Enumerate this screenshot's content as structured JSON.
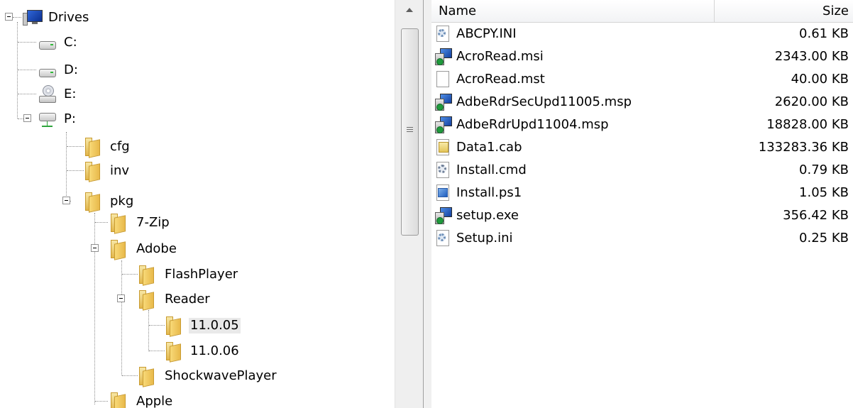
{
  "tree": {
    "root": {
      "label": "Drives",
      "icon": "computer-icon"
    },
    "drives": [
      {
        "label": "C:",
        "icon": "drive-icon"
      },
      {
        "label": "D:",
        "icon": "drive-icon"
      },
      {
        "label": "E:",
        "icon": "optical-drive-icon"
      },
      {
        "label": "P:",
        "icon": "network-drive-icon"
      }
    ],
    "p_children": [
      {
        "label": "cfg"
      },
      {
        "label": "inv"
      },
      {
        "label": "pkg"
      }
    ],
    "pkg_children": [
      {
        "label": "7-Zip"
      },
      {
        "label": "Adobe"
      }
    ],
    "adobe_children": [
      {
        "label": "FlashPlayer"
      },
      {
        "label": "Reader"
      },
      {
        "label": "ShockwavePlayer"
      }
    ],
    "reader_children": [
      {
        "label": "11.0.05",
        "selected": true
      },
      {
        "label": "11.0.06"
      }
    ],
    "after_adobe": [
      {
        "label": "Apple"
      }
    ]
  },
  "list": {
    "columns": {
      "name": "Name",
      "size": "Size"
    },
    "files": [
      {
        "name": "ABCPY.INI",
        "size": "0.61 KB",
        "icon": "ini-icon"
      },
      {
        "name": "AcroRead.msi",
        "size": "2343.00 KB",
        "icon": "installer-icon"
      },
      {
        "name": "AcroRead.mst",
        "size": "40.00 KB",
        "icon": "blank-file-icon"
      },
      {
        "name": "AdbeRdrSecUpd11005.msp",
        "size": "2620.00 KB",
        "icon": "installer-icon"
      },
      {
        "name": "AdbeRdrUpd11004.msp",
        "size": "18828.00 KB",
        "icon": "installer-icon"
      },
      {
        "name": "Data1.cab",
        "size": "133283.36 KB",
        "icon": "cabinet-icon"
      },
      {
        "name": "Install.cmd",
        "size": "0.79 KB",
        "icon": "script-icon"
      },
      {
        "name": "Install.ps1",
        "size": "1.05 KB",
        "icon": "powershell-icon"
      },
      {
        "name": "setup.exe",
        "size": "356.42 KB",
        "icon": "installer-icon"
      },
      {
        "name": "Setup.ini",
        "size": "0.25 KB",
        "icon": "ini-icon"
      }
    ]
  },
  "colors": {
    "selection": "#e9e9e9",
    "scrollbar": "#efefef",
    "header_border": "#d5d5d5"
  }
}
